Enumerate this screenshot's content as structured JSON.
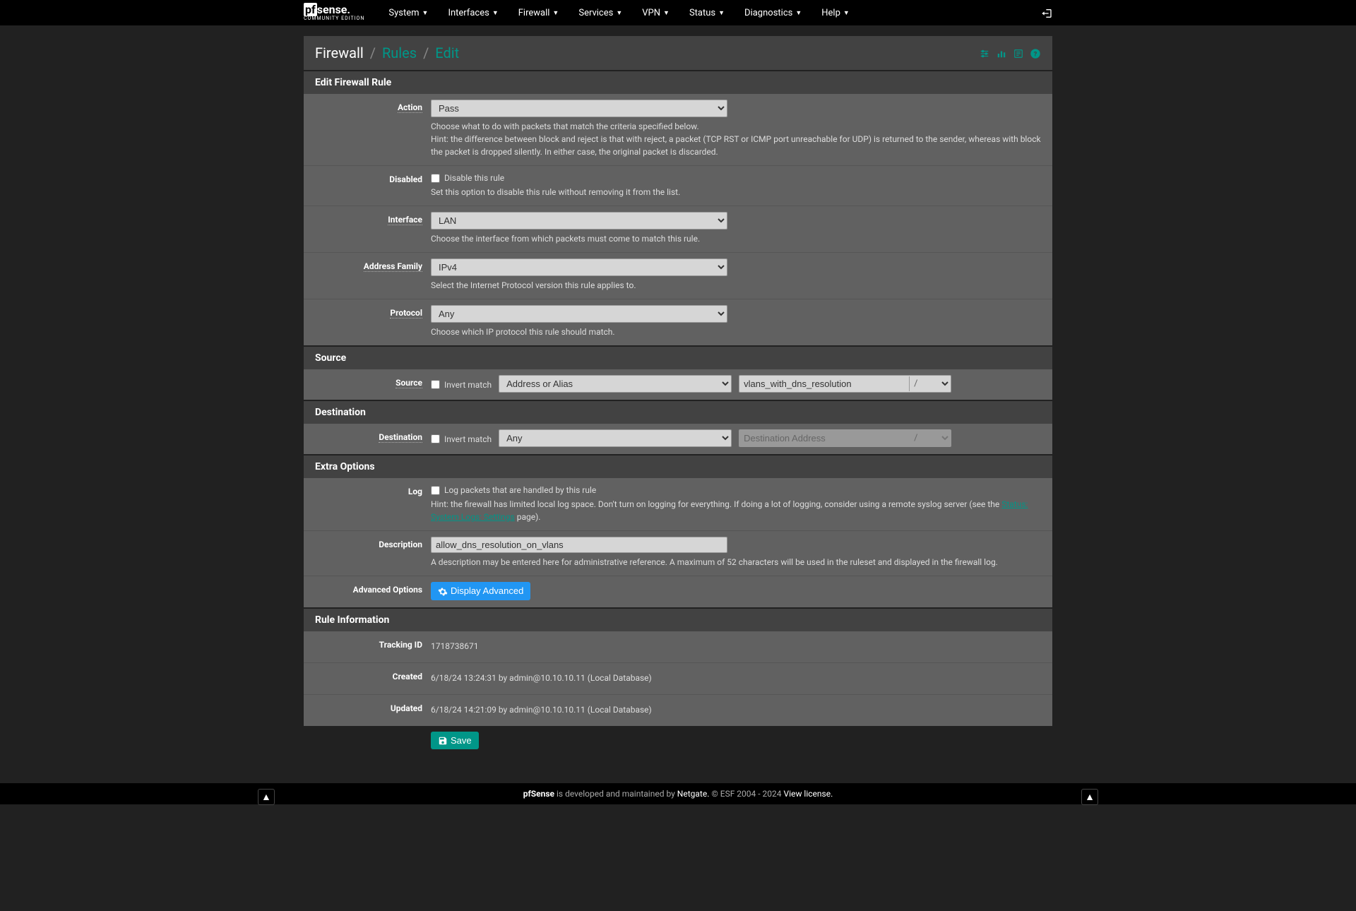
{
  "logo": {
    "main": "pfsense",
    "sub": "COMMUNITY EDITION"
  },
  "nav": [
    "System",
    "Interfaces",
    "Firewall",
    "Services",
    "VPN",
    "Status",
    "Diagnostics",
    "Help"
  ],
  "breadcrumb": {
    "root": "Firewall",
    "section": "Rules",
    "page": "Edit"
  },
  "panels": {
    "edit_rule": {
      "title": "Edit Firewall Rule",
      "action": {
        "label": "Action",
        "value": "Pass",
        "help": "Choose what to do with packets that match the criteria specified below.\nHint: the difference between block and reject is that with reject, a packet (TCP RST or ICMP port unreachable for UDP) is returned to the sender, whereas with block the packet is dropped silently. In either case, the original packet is discarded."
      },
      "disabled": {
        "label": "Disabled",
        "checkbox_label": "Disable this rule",
        "help": "Set this option to disable this rule without removing it from the list."
      },
      "interface": {
        "label": "Interface",
        "value": "LAN",
        "help": "Choose the interface from which packets must come to match this rule."
      },
      "address_family": {
        "label": "Address Family",
        "value": "IPv4",
        "help": "Select the Internet Protocol version this rule applies to."
      },
      "protocol": {
        "label": "Protocol",
        "value": "Any",
        "help": "Choose which IP protocol this rule should match."
      }
    },
    "source": {
      "title": "Source",
      "label": "Source",
      "invert_label": "Invert match",
      "type_value": "Address or Alias",
      "addr_value": "vlans_with_dns_resolution",
      "mask": "/"
    },
    "destination": {
      "title": "Destination",
      "label": "Destination",
      "invert_label": "Invert match",
      "type_value": "Any",
      "addr_placeholder": "Destination Address",
      "mask": "/"
    },
    "extra": {
      "title": "Extra Options",
      "log": {
        "label": "Log",
        "checkbox_label": "Log packets that are handled by this rule",
        "help_pre": "Hint: the firewall has limited local log space. Don't turn on logging for everything. If doing a lot of logging, consider using a remote syslog server (see the ",
        "help_link": "Status: System Logs: Settings",
        "help_post": " page)."
      },
      "description": {
        "label": "Description",
        "value": "allow_dns_resolution_on_vlans",
        "help": "A description may be entered here for administrative reference. A maximum of 52 characters will be used in the ruleset and displayed in the firewall log."
      },
      "advanced": {
        "label": "Advanced Options",
        "button": "Display Advanced"
      }
    },
    "info": {
      "title": "Rule Information",
      "tracking_id": {
        "label": "Tracking ID",
        "value": "1718738671"
      },
      "created": {
        "label": "Created",
        "value": "6/18/24 13:24:31 by admin@10.10.10.11 (Local Database)"
      },
      "updated": {
        "label": "Updated",
        "value": "6/18/24 14:21:09 by admin@10.10.10.11 (Local Database)"
      }
    }
  },
  "save_button": "Save",
  "footer": {
    "brand": "pfSense",
    "text1": " is developed and maintained by ",
    "netgate": "Netgate.",
    "copyright": " © ESF 2004 - 2024 ",
    "license": "View license."
  }
}
